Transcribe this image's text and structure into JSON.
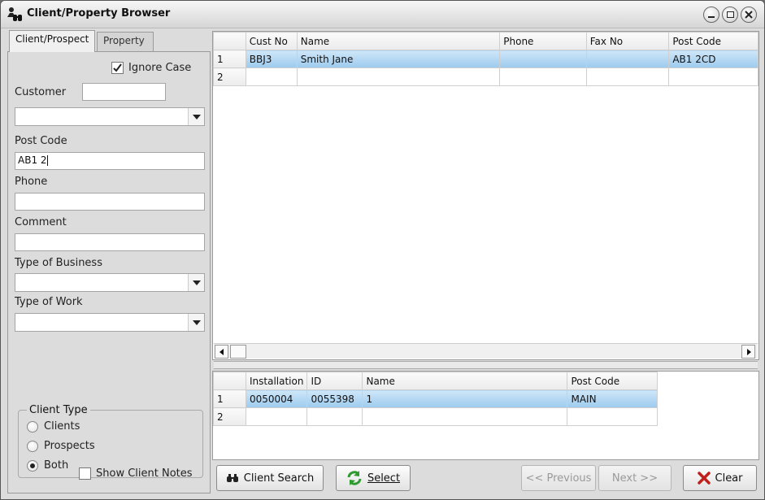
{
  "window": {
    "title": "Client/Property Browser"
  },
  "tabs": [
    {
      "label": "Client/Prospect"
    },
    {
      "label": "Property"
    }
  ],
  "form": {
    "ignore_case": {
      "label": "Ignore Case",
      "checked": true
    },
    "customer_label": "Customer",
    "customer_value": "",
    "customer_combo_value": "",
    "postcode_label": "Post Code",
    "postcode_value": "AB1 2",
    "phone_label": "Phone",
    "phone_value": "",
    "comment_label": "Comment",
    "comment_value": "",
    "business_label": "Type of Business",
    "business_value": "",
    "work_label": "Type of Work",
    "work_value": "",
    "client_type": {
      "legend": "Client Type",
      "options": [
        "Clients",
        "Prospects",
        "Both"
      ],
      "selected": "Both"
    },
    "show_notes": {
      "label": "Show Client Notes",
      "checked": false
    }
  },
  "clients_grid": {
    "columns": [
      "Cust No",
      "Name",
      "Phone",
      "Fax No",
      "Post Code"
    ],
    "rows": [
      {
        "num": "1",
        "cells": [
          "BBJ3",
          "Smith Jane",
          "",
          "",
          "AB1 2CD"
        ],
        "selected": true
      },
      {
        "num": "2",
        "cells": [
          "",
          "",
          "",
          "",
          ""
        ],
        "selected": false
      }
    ]
  },
  "property_grid": {
    "columns": [
      "Installation",
      "ID",
      "Name",
      "Post Code"
    ],
    "rows": [
      {
        "num": "1",
        "cells": [
          "0050004",
          "0055398",
          "1",
          "MAIN"
        ],
        "selected": true
      },
      {
        "num": "2",
        "cells": [
          "",
          "",
          "",
          ""
        ],
        "selected": false
      }
    ]
  },
  "buttons": {
    "client_search": "Client Search",
    "select": "Select",
    "previous": "<< Previous",
    "next": "Next >>",
    "clear": "Clear"
  },
  "colors": {
    "selection": "#9ccaee",
    "clear_icon": "#c0201c",
    "select_icon": "#2f9a2f"
  }
}
